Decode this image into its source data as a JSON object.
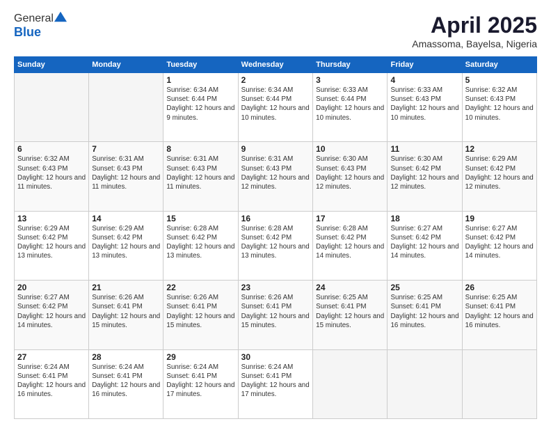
{
  "logo": {
    "general": "General",
    "blue": "Blue"
  },
  "header": {
    "month": "April 2025",
    "location": "Amassoma, Bayelsa, Nigeria"
  },
  "weekdays": [
    "Sunday",
    "Monday",
    "Tuesday",
    "Wednesday",
    "Thursday",
    "Friday",
    "Saturday"
  ],
  "weeks": [
    [
      {
        "day": "",
        "info": ""
      },
      {
        "day": "",
        "info": ""
      },
      {
        "day": "1",
        "info": "Sunrise: 6:34 AM\nSunset: 6:44 PM\nDaylight: 12 hours and 9 minutes."
      },
      {
        "day": "2",
        "info": "Sunrise: 6:34 AM\nSunset: 6:44 PM\nDaylight: 12 hours and 10 minutes."
      },
      {
        "day": "3",
        "info": "Sunrise: 6:33 AM\nSunset: 6:44 PM\nDaylight: 12 hours and 10 minutes."
      },
      {
        "day": "4",
        "info": "Sunrise: 6:33 AM\nSunset: 6:43 PM\nDaylight: 12 hours and 10 minutes."
      },
      {
        "day": "5",
        "info": "Sunrise: 6:32 AM\nSunset: 6:43 PM\nDaylight: 12 hours and 10 minutes."
      }
    ],
    [
      {
        "day": "6",
        "info": "Sunrise: 6:32 AM\nSunset: 6:43 PM\nDaylight: 12 hours and 11 minutes."
      },
      {
        "day": "7",
        "info": "Sunrise: 6:31 AM\nSunset: 6:43 PM\nDaylight: 12 hours and 11 minutes."
      },
      {
        "day": "8",
        "info": "Sunrise: 6:31 AM\nSunset: 6:43 PM\nDaylight: 12 hours and 11 minutes."
      },
      {
        "day": "9",
        "info": "Sunrise: 6:31 AM\nSunset: 6:43 PM\nDaylight: 12 hours and 12 minutes."
      },
      {
        "day": "10",
        "info": "Sunrise: 6:30 AM\nSunset: 6:43 PM\nDaylight: 12 hours and 12 minutes."
      },
      {
        "day": "11",
        "info": "Sunrise: 6:30 AM\nSunset: 6:42 PM\nDaylight: 12 hours and 12 minutes."
      },
      {
        "day": "12",
        "info": "Sunrise: 6:29 AM\nSunset: 6:42 PM\nDaylight: 12 hours and 12 minutes."
      }
    ],
    [
      {
        "day": "13",
        "info": "Sunrise: 6:29 AM\nSunset: 6:42 PM\nDaylight: 12 hours and 13 minutes."
      },
      {
        "day": "14",
        "info": "Sunrise: 6:29 AM\nSunset: 6:42 PM\nDaylight: 12 hours and 13 minutes."
      },
      {
        "day": "15",
        "info": "Sunrise: 6:28 AM\nSunset: 6:42 PM\nDaylight: 12 hours and 13 minutes."
      },
      {
        "day": "16",
        "info": "Sunrise: 6:28 AM\nSunset: 6:42 PM\nDaylight: 12 hours and 13 minutes."
      },
      {
        "day": "17",
        "info": "Sunrise: 6:28 AM\nSunset: 6:42 PM\nDaylight: 12 hours and 14 minutes."
      },
      {
        "day": "18",
        "info": "Sunrise: 6:27 AM\nSunset: 6:42 PM\nDaylight: 12 hours and 14 minutes."
      },
      {
        "day": "19",
        "info": "Sunrise: 6:27 AM\nSunset: 6:42 PM\nDaylight: 12 hours and 14 minutes."
      }
    ],
    [
      {
        "day": "20",
        "info": "Sunrise: 6:27 AM\nSunset: 6:42 PM\nDaylight: 12 hours and 14 minutes."
      },
      {
        "day": "21",
        "info": "Sunrise: 6:26 AM\nSunset: 6:41 PM\nDaylight: 12 hours and 15 minutes."
      },
      {
        "day": "22",
        "info": "Sunrise: 6:26 AM\nSunset: 6:41 PM\nDaylight: 12 hours and 15 minutes."
      },
      {
        "day": "23",
        "info": "Sunrise: 6:26 AM\nSunset: 6:41 PM\nDaylight: 12 hours and 15 minutes."
      },
      {
        "day": "24",
        "info": "Sunrise: 6:25 AM\nSunset: 6:41 PM\nDaylight: 12 hours and 15 minutes."
      },
      {
        "day": "25",
        "info": "Sunrise: 6:25 AM\nSunset: 6:41 PM\nDaylight: 12 hours and 16 minutes."
      },
      {
        "day": "26",
        "info": "Sunrise: 6:25 AM\nSunset: 6:41 PM\nDaylight: 12 hours and 16 minutes."
      }
    ],
    [
      {
        "day": "27",
        "info": "Sunrise: 6:24 AM\nSunset: 6:41 PM\nDaylight: 12 hours and 16 minutes."
      },
      {
        "day": "28",
        "info": "Sunrise: 6:24 AM\nSunset: 6:41 PM\nDaylight: 12 hours and 16 minutes."
      },
      {
        "day": "29",
        "info": "Sunrise: 6:24 AM\nSunset: 6:41 PM\nDaylight: 12 hours and 17 minutes."
      },
      {
        "day": "30",
        "info": "Sunrise: 6:24 AM\nSunset: 6:41 PM\nDaylight: 12 hours and 17 minutes."
      },
      {
        "day": "",
        "info": ""
      },
      {
        "day": "",
        "info": ""
      },
      {
        "day": "",
        "info": ""
      }
    ]
  ]
}
